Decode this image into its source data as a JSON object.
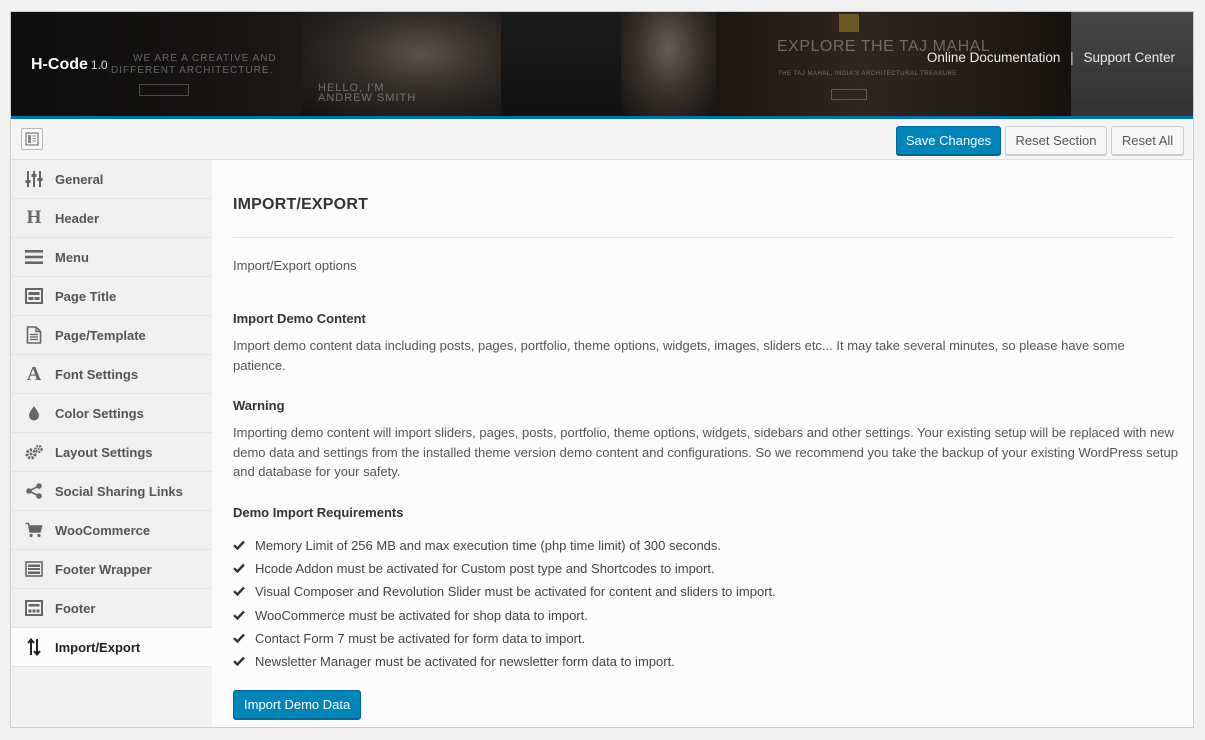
{
  "header": {
    "brand": "H-Code",
    "version": "1.0",
    "links": [
      {
        "label": "Online Documentation"
      },
      {
        "label": "Support Center"
      }
    ],
    "separator": "|",
    "background_texts": {
      "tagline_1": "WE ARE A CREATIVE AND",
      "tagline_2": "DIFFERENT ARCHITECTURE.",
      "hello_1": "HELLO, I'M",
      "hello_2": "ANDREW SMITH",
      "explore": "EXPLORE THE TAJ MAHAL",
      "explore_sub": "THE TAJ MAHAL, INDIA'S ARCHITECTURAL TREASURE"
    }
  },
  "toolbar": {
    "save": "Save Changes",
    "reset_section": "Reset Section",
    "reset_all": "Reset All"
  },
  "sidebar": {
    "items": [
      {
        "label": "General",
        "icon": "sliders-icon"
      },
      {
        "label": "Header",
        "icon": "header-h-icon"
      },
      {
        "label": "Menu",
        "icon": "menu-bars-icon"
      },
      {
        "label": "Page Title",
        "icon": "page-title-icon"
      },
      {
        "label": "Page/Template",
        "icon": "document-icon"
      },
      {
        "label": "Font Settings",
        "icon": "font-a-icon"
      },
      {
        "label": "Color Settings",
        "icon": "color-drop-icon"
      },
      {
        "label": "Layout Settings",
        "icon": "gears-icon"
      },
      {
        "label": "Social Sharing Links",
        "icon": "share-icon"
      },
      {
        "label": "WooCommerce",
        "icon": "cart-icon"
      },
      {
        "label": "Footer Wrapper",
        "icon": "footer-wrapper-icon"
      },
      {
        "label": "Footer",
        "icon": "footer-icon"
      },
      {
        "label": "Import/Export",
        "icon": "import-export-icon",
        "active": true
      }
    ]
  },
  "main": {
    "title": "IMPORT/EXPORT",
    "subtitle": "Import/Export options",
    "import_heading": "Import Demo Content",
    "import_text": "Import demo content data including posts, pages, portfolio, theme options, widgets, images, sliders etc... It may take several minutes, so please have some patience.",
    "warning_heading": "Warning",
    "warning_text": "Importing demo content will import sliders, pages, posts, portfolio, theme options, widgets, sidebars and other settings. Your existing setup will be replaced with new demo data and settings from the installed theme version demo content and configurations. So we recommend you take the backup of your existing WordPress setup and database for your safety.",
    "requirements_heading": "Demo Import Requirements",
    "requirements": [
      "Memory Limit of 256 MB and max execution time (php time limit) of 300 seconds.",
      "Hcode Addon must be activated for Custom post type and Shortcodes to import.",
      "Visual Composer and Revolution Slider must be activated for content and sliders to import.",
      "WooCommerce must be activated for shop data to import.",
      "Contact Form 7 must be activated for form data to import.",
      "Newsletter Manager must be activated for newsletter form data to import."
    ],
    "import_button": "Import Demo Data"
  },
  "colors": {
    "accent": "#0085ba",
    "header_border": "#0073aa"
  }
}
